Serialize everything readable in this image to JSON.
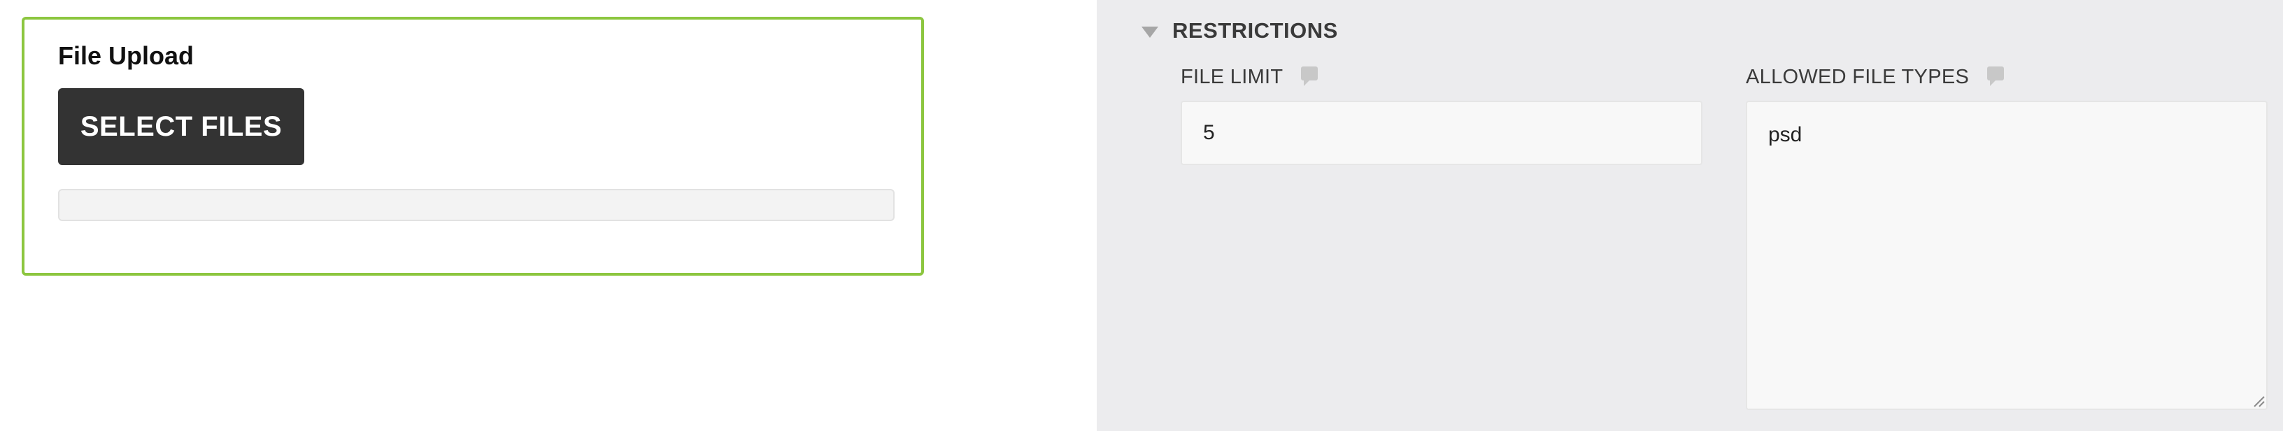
{
  "upload": {
    "title": "File Upload",
    "select_button_label": "SELECT FILES",
    "progress_fraction": 0
  },
  "restrictions": {
    "section_title": "RESTRICTIONS",
    "file_limit": {
      "label": "FILE LIMIT",
      "value": "5"
    },
    "allowed_file_types": {
      "label": "ALLOWED FILE TYPES",
      "value": "psd"
    }
  },
  "colors": {
    "card_border": "#8cc63f",
    "button_bg": "#333333",
    "panel_bg": "#ececee"
  },
  "icons": {
    "collapse": "triangle-down-icon",
    "comment": "comment-icon",
    "resize": "resize-handle-icon"
  }
}
